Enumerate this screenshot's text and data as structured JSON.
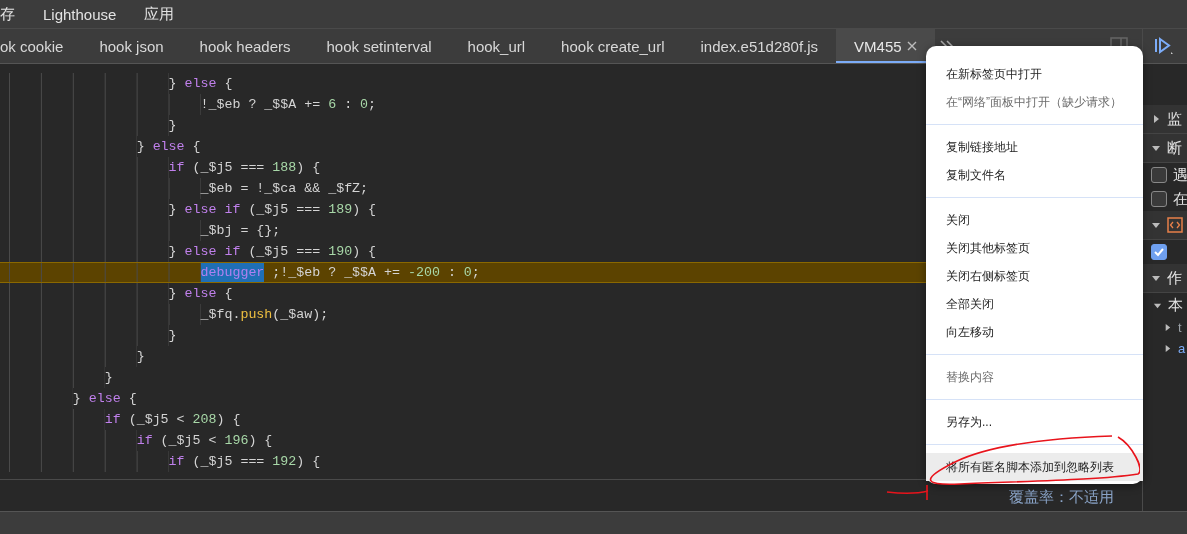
{
  "menu_bar": [
    "存",
    "Lighthouse",
    "应用"
  ],
  "tabs": [
    {
      "label": "ok cookie",
      "selected": false,
      "closable": false
    },
    {
      "label": "hook json",
      "selected": false,
      "closable": false
    },
    {
      "label": "hook headers",
      "selected": false,
      "closable": false
    },
    {
      "label": "hook setinterval",
      "selected": false,
      "closable": false
    },
    {
      "label": "hook_url",
      "selected": false,
      "closable": false
    },
    {
      "label": "hook create_url",
      "selected": false,
      "closable": false
    },
    {
      "label": "index.e51d280f.js",
      "selected": false,
      "closable": false
    },
    {
      "label": "VM455",
      "selected": true,
      "closable": true
    }
  ],
  "code_lines": [
    {
      "current": false,
      "tokens": [
        {
          "kind": "plain",
          "text": "                    } "
        },
        {
          "kind": "keyword",
          "text": "else"
        },
        {
          "kind": "plain",
          "text": " {"
        }
      ]
    },
    {
      "current": false,
      "tokens": [
        {
          "kind": "plain",
          "text": "                        !_$eb ? _$$A += "
        },
        {
          "kind": "number",
          "text": "6"
        },
        {
          "kind": "plain",
          "text": " : "
        },
        {
          "kind": "number",
          "text": "0"
        },
        {
          "kind": "plain",
          "text": ";"
        }
      ]
    },
    {
      "current": false,
      "tokens": [
        {
          "kind": "plain",
          "text": "                    }"
        }
      ]
    },
    {
      "current": false,
      "tokens": [
        {
          "kind": "plain",
          "text": "                } "
        },
        {
          "kind": "keyword",
          "text": "else"
        },
        {
          "kind": "plain",
          "text": " {"
        }
      ]
    },
    {
      "current": false,
      "tokens": [
        {
          "kind": "keyword",
          "text": "                    if"
        },
        {
          "kind": "plain",
          "text": " (_$j5 === "
        },
        {
          "kind": "number",
          "text": "188"
        },
        {
          "kind": "plain",
          "text": ") {"
        }
      ]
    },
    {
      "current": false,
      "tokens": [
        {
          "kind": "plain",
          "text": "                        _$eb = !_$ca && _$fZ;"
        }
      ]
    },
    {
      "current": false,
      "tokens": [
        {
          "kind": "plain",
          "text": "                    } "
        },
        {
          "kind": "keyword",
          "text": "else if"
        },
        {
          "kind": "plain",
          "text": " (_$j5 === "
        },
        {
          "kind": "number",
          "text": "189"
        },
        {
          "kind": "plain",
          "text": ") {"
        }
      ]
    },
    {
      "current": false,
      "tokens": [
        {
          "kind": "plain",
          "text": "                        _$bj = {};"
        }
      ]
    },
    {
      "current": false,
      "tokens": [
        {
          "kind": "plain",
          "text": "                    } "
        },
        {
          "kind": "keyword",
          "text": "else if"
        },
        {
          "kind": "plain",
          "text": " (_$j5 === "
        },
        {
          "kind": "number",
          "text": "190"
        },
        {
          "kind": "plain",
          "text": ") {"
        }
      ]
    },
    {
      "current": true,
      "tokens": [
        {
          "kind": "match",
          "text": "                        debugger"
        },
        {
          "kind": "plain",
          "text": " ;!_$eb ? _$$A += "
        },
        {
          "kind": "number",
          "text": "-200"
        },
        {
          "kind": "plain",
          "text": " : "
        },
        {
          "kind": "number",
          "text": "0"
        },
        {
          "kind": "plain",
          "text": ";"
        }
      ]
    },
    {
      "current": false,
      "tokens": [
        {
          "kind": "plain",
          "text": "                    } "
        },
        {
          "kind": "keyword",
          "text": "else"
        },
        {
          "kind": "plain",
          "text": " {"
        }
      ]
    },
    {
      "current": false,
      "tokens": [
        {
          "kind": "plain",
          "text": "                        _$fq."
        },
        {
          "kind": "method",
          "text": "push"
        },
        {
          "kind": "plain",
          "text": "(_$aw);"
        }
      ]
    },
    {
      "current": false,
      "tokens": [
        {
          "kind": "plain",
          "text": "                    }"
        }
      ]
    },
    {
      "current": false,
      "tokens": [
        {
          "kind": "plain",
          "text": "                }"
        }
      ]
    },
    {
      "current": false,
      "tokens": [
        {
          "kind": "plain",
          "text": "            }"
        }
      ]
    },
    {
      "current": false,
      "tokens": [
        {
          "kind": "plain",
          "text": "        } "
        },
        {
          "kind": "keyword",
          "text": "else"
        },
        {
          "kind": "plain",
          "text": " {"
        }
      ]
    },
    {
      "current": false,
      "tokens": [
        {
          "kind": "keyword",
          "text": "            if"
        },
        {
          "kind": "plain",
          "text": " (_$j5 < "
        },
        {
          "kind": "number",
          "text": "208"
        },
        {
          "kind": "plain",
          "text": ") {"
        }
      ]
    },
    {
      "current": false,
      "tokens": [
        {
          "kind": "keyword",
          "text": "                if"
        },
        {
          "kind": "plain",
          "text": " (_$j5 < "
        },
        {
          "kind": "number",
          "text": "196"
        },
        {
          "kind": "plain",
          "text": ") {"
        }
      ]
    },
    {
      "current": false,
      "tokens": [
        {
          "kind": "keyword",
          "text": "                    if"
        },
        {
          "kind": "plain",
          "text": " (_$j5 === "
        },
        {
          "kind": "number",
          "text": "192"
        },
        {
          "kind": "plain",
          "text": ") {"
        }
      ]
    }
  ],
  "status_bar": {
    "coverage": "覆盖率：不适用"
  },
  "side_panel": [
    {
      "kind": "section",
      "label": "监",
      "expanded": false
    },
    {
      "kind": "section",
      "label": "断",
      "expanded": true
    },
    {
      "kind": "checkbox",
      "label": "遇",
      "checked": false
    },
    {
      "kind": "checkbox",
      "label": "在",
      "checked": false
    },
    {
      "kind": "source",
      "expanded": true
    },
    {
      "kind": "checkbox",
      "checked": true
    },
    {
      "kind": "section",
      "label": "作",
      "expanded": true
    },
    {
      "kind": "tree",
      "label": "本",
      "expanded": true,
      "color": "#e3e3e3"
    },
    {
      "kind": "tree",
      "label": "t",
      "expanded": false,
      "color": "#9aa0a6"
    },
    {
      "kind": "tree",
      "label": "a",
      "expanded": false,
      "color": "#7cacf8"
    }
  ],
  "context_menu": [
    [
      {
        "label": "在新标签页中打开",
        "disabled": false,
        "hovered": false
      },
      {
        "label": "在“网络”面板中打开（缺少请求）",
        "disabled": true,
        "hovered": false
      }
    ],
    [
      {
        "label": "复制链接地址",
        "disabled": false,
        "hovered": false
      },
      {
        "label": "复制文件名",
        "disabled": false,
        "hovered": false
      }
    ],
    [
      {
        "label": "关闭",
        "disabled": false,
        "hovered": false
      },
      {
        "label": "关闭其他标签页",
        "disabled": false,
        "hovered": false
      },
      {
        "label": "关闭右侧标签页",
        "disabled": false,
        "hovered": false
      },
      {
        "label": "全部关闭",
        "disabled": false,
        "hovered": false
      },
      {
        "label": "向左移动",
        "disabled": false,
        "hovered": false
      }
    ],
    [
      {
        "label": "替换内容",
        "disabled": true,
        "hovered": false
      }
    ],
    [
      {
        "label": "另存为...",
        "disabled": false,
        "hovered": false
      }
    ],
    [
      {
        "label": "将所有匿名脚本添加到忽略列表",
        "disabled": false,
        "hovered": true
      }
    ]
  ]
}
